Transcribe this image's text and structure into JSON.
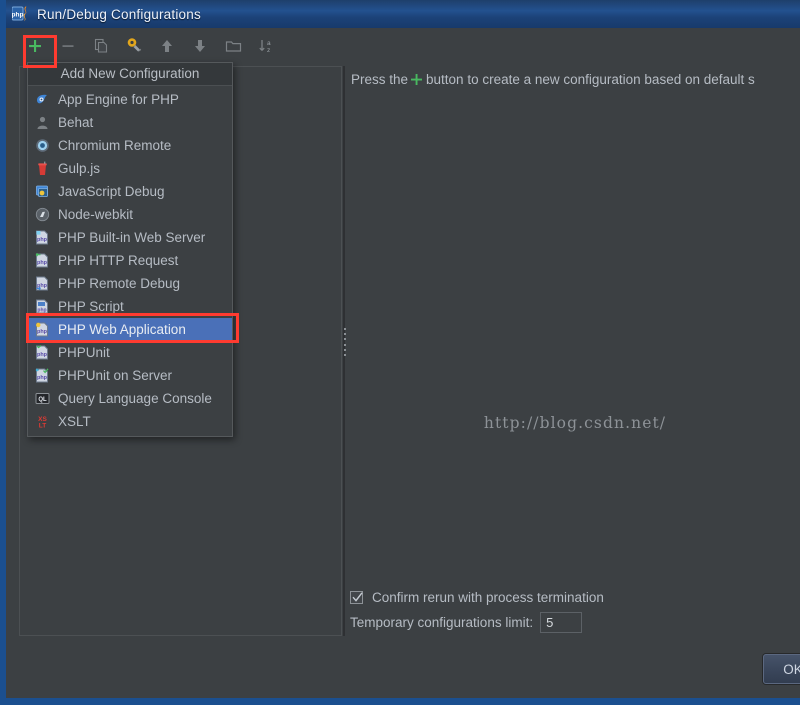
{
  "window": {
    "title": "Run/Debug Configurations",
    "app_icon": "phpstorm-icon",
    "border_color": "#1b4f8f",
    "background": "#3c4043"
  },
  "toolbar": {
    "buttons": [
      {
        "name": "add-configuration-button",
        "icon": "plus-icon",
        "label": "+",
        "highlighted": true
      },
      {
        "name": "remove-configuration-button",
        "icon": "minus-icon",
        "label": "-",
        "highlighted": false
      },
      {
        "name": "copy-configuration-button",
        "icon": "copy-icon",
        "label": "Copy",
        "highlighted": false
      },
      {
        "name": "edit-defaults-button",
        "icon": "wrench-icon",
        "label": "Edit defaults",
        "highlighted": false
      },
      {
        "name": "move-up-button",
        "icon": "arrow-up-icon",
        "label": "Move Up",
        "highlighted": false
      },
      {
        "name": "move-down-button",
        "icon": "arrow-down-icon",
        "label": "Move Down",
        "highlighted": false
      },
      {
        "name": "create-folder-button",
        "icon": "folder-icon",
        "label": "Create Folder",
        "highlighted": false
      },
      {
        "name": "sort-alphabetically-button",
        "icon": "sort-az-icon",
        "label": "Sort Alphabetically",
        "highlighted": false
      }
    ],
    "highlight_color": "#ff3b30",
    "plus_color": "#49b860"
  },
  "menu": {
    "header": "Add New Configuration",
    "selected_index": 10,
    "selection_color": "#4a70b8",
    "highlight_color": "#ff3b30",
    "items": [
      {
        "label": "App Engine for PHP",
        "icon": "app-engine-icon"
      },
      {
        "label": "Behat",
        "icon": "behat-icon"
      },
      {
        "label": "Chromium Remote",
        "icon": "chromium-icon"
      },
      {
        "label": "Gulp.js",
        "icon": "gulp-icon"
      },
      {
        "label": "JavaScript Debug",
        "icon": "javascript-debug-icon"
      },
      {
        "label": "Node-webkit",
        "icon": "node-webkit-icon"
      },
      {
        "label": "PHP Built-in Web Server",
        "icon": "php-server-icon"
      },
      {
        "label": "PHP HTTP Request",
        "icon": "php-http-request-icon"
      },
      {
        "label": "PHP Remote Debug",
        "icon": "php-remote-debug-icon"
      },
      {
        "label": "PHP Script",
        "icon": "php-script-icon"
      },
      {
        "label": "PHP Web Application",
        "icon": "php-web-application-icon"
      },
      {
        "label": "PHPUnit",
        "icon": "phpunit-icon"
      },
      {
        "label": "PHPUnit on Server",
        "icon": "phpunit-server-icon"
      },
      {
        "label": "Query Language Console",
        "icon": "query-console-icon"
      },
      {
        "label": "XSLT",
        "icon": "xslt-icon"
      }
    ]
  },
  "right_panel": {
    "hint_before": "Press the",
    "hint_after": "button to create a new configuration based on default s",
    "hint_icon": "plus-icon",
    "watermark": "http://blog.csdn.net/",
    "confirm_rerun": {
      "label": "Confirm rerun with process termination",
      "checked": true
    },
    "temporary_limit": {
      "label": "Temporary configurations limit:",
      "value": "5"
    }
  },
  "footer": {
    "ok_label": "OK"
  }
}
